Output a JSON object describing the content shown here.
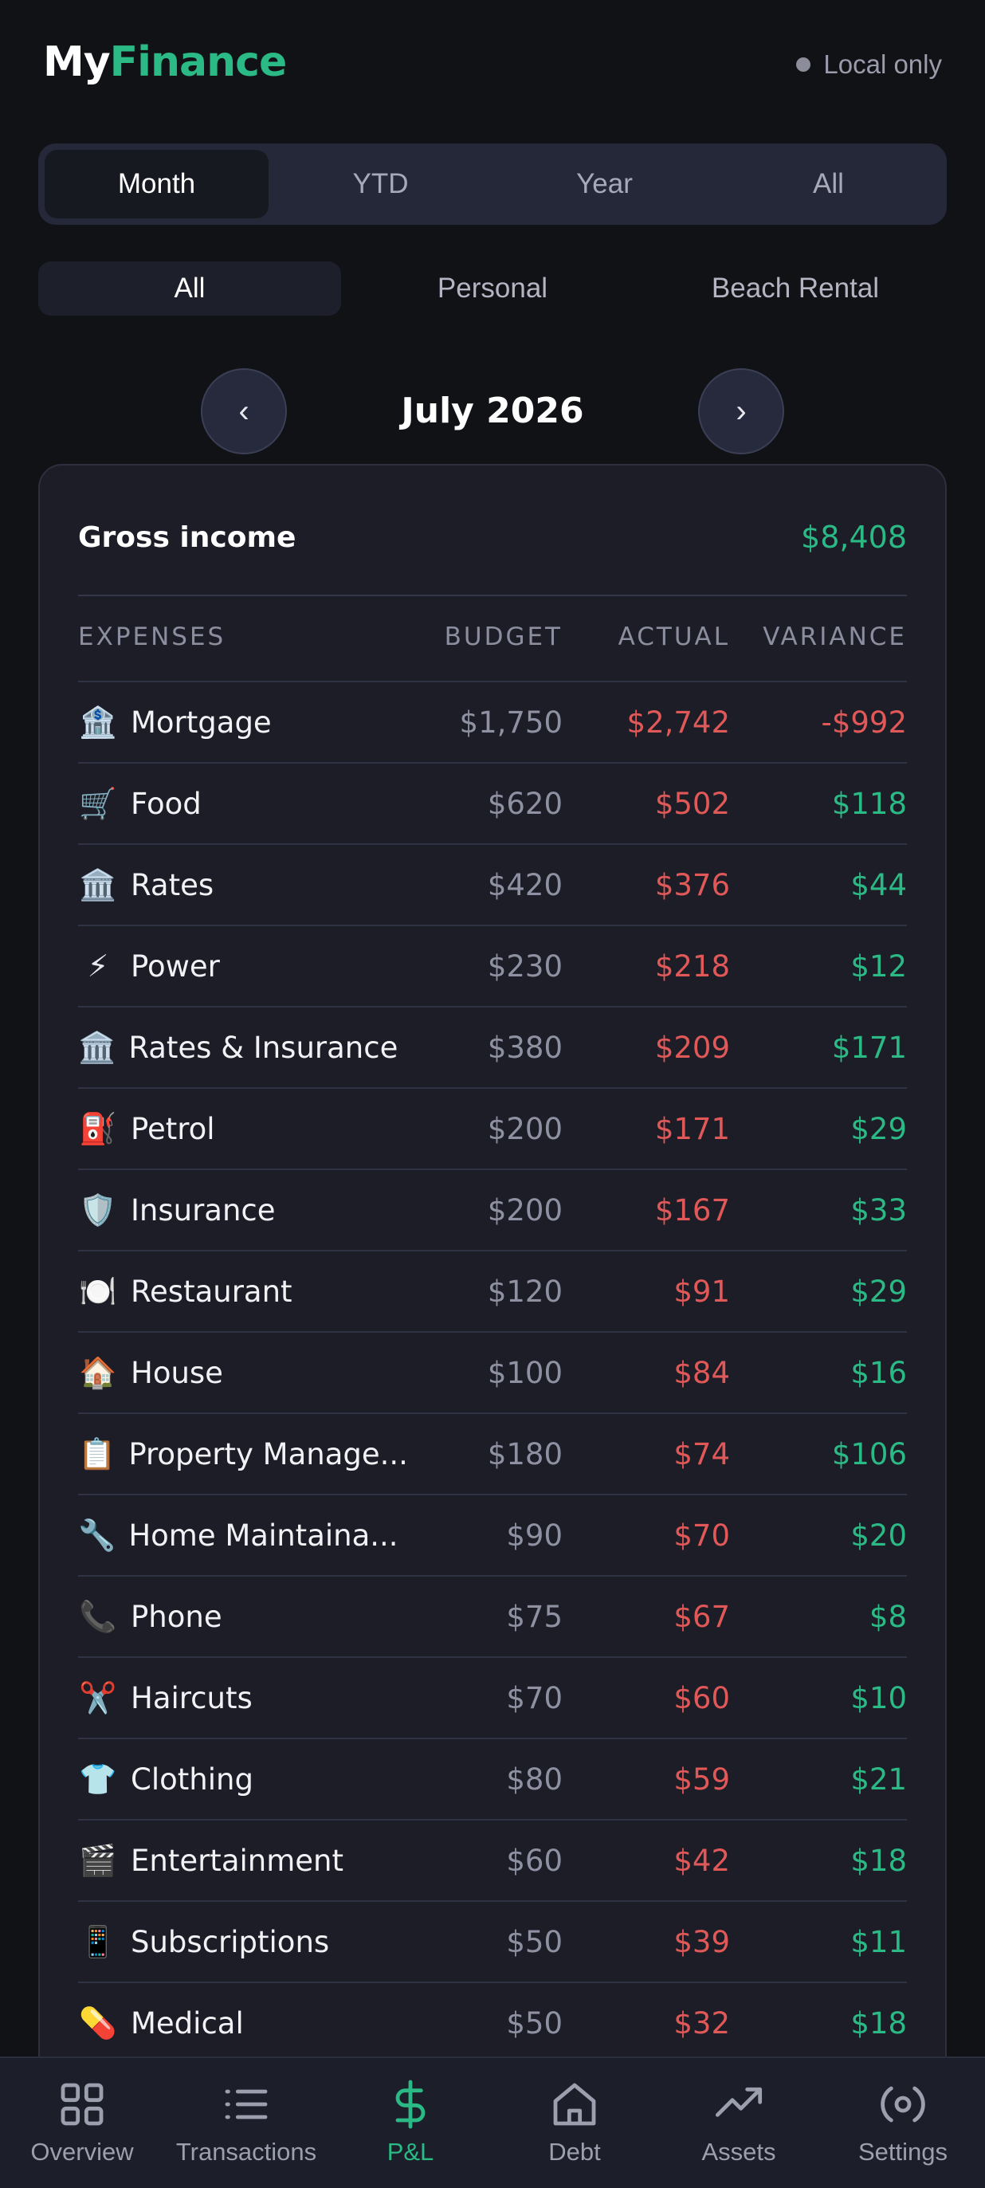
{
  "header": {
    "brand_my": "My",
    "brand_finance": "Finance",
    "status": "Local only"
  },
  "period_tabs": [
    "Month",
    "YTD",
    "Year",
    "All"
  ],
  "entity_tabs": [
    "All",
    "Personal",
    "Beach Rental"
  ],
  "month_nav": {
    "prev": "‹",
    "title": "July 2026",
    "next": "›"
  },
  "summary": {
    "gross_income_label": "Gross income",
    "gross_income_value": "$8,408"
  },
  "columns": {
    "name": "EXPENSES",
    "budget": "BUDGET",
    "actual": "ACTUAL",
    "variance": "VARIANCE"
  },
  "expenses": [
    {
      "icon": "🏦",
      "icon_name": "bank-icon",
      "name": "Mortgage",
      "budget": "$1,750",
      "actual": "$2,742",
      "variance": "-$992",
      "sign": "neg"
    },
    {
      "icon": "🛒",
      "icon_name": "shopping-cart-icon",
      "name": "Food",
      "budget": "$620",
      "actual": "$502",
      "variance": "$118",
      "sign": "pos"
    },
    {
      "icon": "🏛️",
      "icon_name": "government-building-icon",
      "name": "Rates",
      "budget": "$420",
      "actual": "$376",
      "variance": "$44",
      "sign": "pos"
    },
    {
      "icon": "⚡",
      "icon_name": "lightning-icon",
      "name": "Power",
      "budget": "$230",
      "actual": "$218",
      "variance": "$12",
      "sign": "pos"
    },
    {
      "icon": "🏛️",
      "icon_name": "government-building-icon",
      "name": "Rates & Insurance",
      "budget": "$380",
      "actual": "$209",
      "variance": "$171",
      "sign": "pos"
    },
    {
      "icon": "⛽",
      "icon_name": "fuel-pump-icon",
      "name": "Petrol",
      "budget": "$200",
      "actual": "$171",
      "variance": "$29",
      "sign": "pos"
    },
    {
      "icon": "🛡️",
      "icon_name": "shield-icon",
      "name": "Insurance",
      "budget": "$200",
      "actual": "$167",
      "variance": "$33",
      "sign": "pos"
    },
    {
      "icon": "🍽️",
      "icon_name": "plate-cutlery-icon",
      "name": "Restaurant",
      "budget": "$120",
      "actual": "$91",
      "variance": "$29",
      "sign": "pos"
    },
    {
      "icon": "🏠",
      "icon_name": "house-icon",
      "name": "House",
      "budget": "$100",
      "actual": "$84",
      "variance": "$16",
      "sign": "pos"
    },
    {
      "icon": "📋",
      "icon_name": "clipboard-icon",
      "name": "Property Manage...",
      "budget": "$180",
      "actual": "$74",
      "variance": "$106",
      "sign": "pos"
    },
    {
      "icon": "🔧",
      "icon_name": "wrench-icon",
      "name": "Home Maintaina...",
      "budget": "$90",
      "actual": "$70",
      "variance": "$20",
      "sign": "pos"
    },
    {
      "icon": "📞",
      "icon_name": "phone-icon",
      "name": "Phone",
      "budget": "$75",
      "actual": "$67",
      "variance": "$8",
      "sign": "pos"
    },
    {
      "icon": "✂️",
      "icon_name": "scissors-icon",
      "name": "Haircuts",
      "budget": "$70",
      "actual": "$60",
      "variance": "$10",
      "sign": "pos"
    },
    {
      "icon": "👕",
      "icon_name": "tshirt-icon",
      "name": "Clothing",
      "budget": "$80",
      "actual": "$59",
      "variance": "$21",
      "sign": "pos"
    },
    {
      "icon": "🎬",
      "icon_name": "clapperboard-icon",
      "name": "Entertainment",
      "budget": "$60",
      "actual": "$42",
      "variance": "$18",
      "sign": "pos"
    },
    {
      "icon": "📱",
      "icon_name": "mobile-phone-icon",
      "name": "Subscriptions",
      "budget": "$50",
      "actual": "$39",
      "variance": "$11",
      "sign": "pos"
    },
    {
      "icon": "💊",
      "icon_name": "pill-icon",
      "name": "Medical",
      "budget": "$50",
      "actual": "$32",
      "variance": "$18",
      "sign": "pos"
    }
  ],
  "bottom_nav": [
    {
      "label": "Overview",
      "icon_name": "grid-icon"
    },
    {
      "label": "Transactions",
      "icon_name": "list-icon"
    },
    {
      "label": "P&L",
      "icon_name": "dollar-icon",
      "active": true
    },
    {
      "label": "Debt",
      "icon_name": "home-icon"
    },
    {
      "label": "Assets",
      "icon_name": "trending-up-icon"
    },
    {
      "label": "Settings",
      "icon_name": "settings-icon"
    }
  ],
  "colors": {
    "accent": "#2bb985",
    "negative": "#e05858",
    "background": "#111216",
    "card": "#1c1d26"
  }
}
